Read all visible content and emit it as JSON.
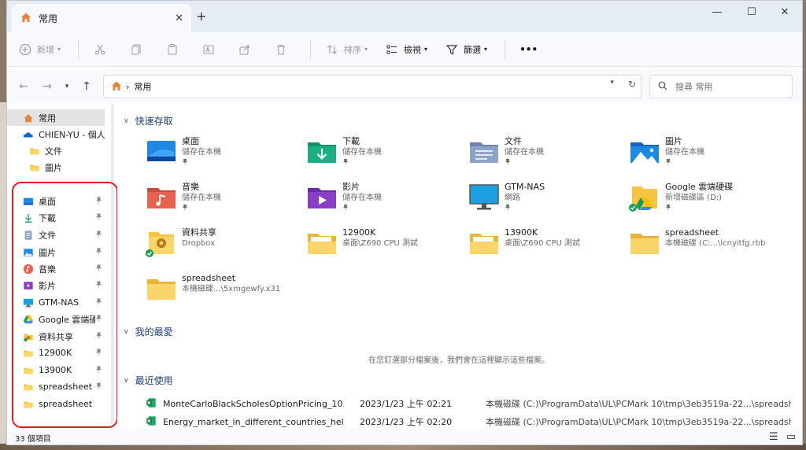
{
  "window": {
    "tab_title": "常用",
    "tab_close": "✕",
    "new_tab": "+",
    "minimize": "—",
    "maximize": "☐",
    "close": "✕"
  },
  "toolbar": {
    "new_label": "新增",
    "sort_label": "排序",
    "view_label": "檢視",
    "filter_label": "篩選",
    "more_label": "•••"
  },
  "address": {
    "path": "常用",
    "separator": "›",
    "search_placeholder": "搜尋 常用"
  },
  "sidebar": {
    "items": [
      {
        "label": "常用",
        "icon": "home-icon",
        "pinned": false,
        "active": true
      },
      {
        "label": "CHIEN-YU - 個人",
        "icon": "onedrive-icon",
        "pinned": false
      },
      {
        "label": "文件",
        "icon": "folder-icon",
        "pinned": false
      },
      {
        "label": "圖片",
        "icon": "folder-icon",
        "pinned": false
      },
      {
        "label": "桌面",
        "icon": "desktop-icon",
        "pinned": true
      },
      {
        "label": "下載",
        "icon": "download-icon",
        "pinned": true
      },
      {
        "label": "文件",
        "icon": "documents-icon",
        "pinned": true
      },
      {
        "label": "圖片",
        "icon": "pictures-icon",
        "pinned": true
      },
      {
        "label": "音樂",
        "icon": "music-icon",
        "pinned": true
      },
      {
        "label": "影片",
        "icon": "videos-icon",
        "pinned": true
      },
      {
        "label": "GTM-NAS",
        "icon": "monitor-icon",
        "pinned": true
      },
      {
        "label": "Google 雲端硬",
        "icon": "google-drive-icon",
        "pinned": true
      },
      {
        "label": "資料共享",
        "icon": "dropbox-folder-icon",
        "pinned": true
      },
      {
        "label": "12900K",
        "icon": "folder-icon",
        "pinned": true
      },
      {
        "label": "13900K",
        "icon": "folder-icon",
        "pinned": true
      },
      {
        "label": "spreadsheet",
        "icon": "folder-icon",
        "pinned": true
      },
      {
        "label": "spreadsheet",
        "icon": "folder-icon",
        "pinned": false
      }
    ],
    "pin_glyph": "📌"
  },
  "quick_access": {
    "heading": "快速存取",
    "items": [
      {
        "name": "桌面",
        "sub": "儲存在本機",
        "icon": "desktop"
      },
      {
        "name": "下載",
        "sub": "儲存在本機",
        "icon": "download"
      },
      {
        "name": "文件",
        "sub": "儲存在本機",
        "icon": "documents"
      },
      {
        "name": "圖片",
        "sub": "儲存在本機",
        "icon": "pictures"
      },
      {
        "name": "音樂",
        "sub": "儲存在本機",
        "icon": "music"
      },
      {
        "name": "影片",
        "sub": "儲存在本機",
        "icon": "videos"
      },
      {
        "name": "GTM-NAS",
        "sub": "網路",
        "icon": "monitor"
      },
      {
        "name": "Google 雲端硬碟",
        "sub": "新增磁碟區 (D:)",
        "icon": "gdrive"
      },
      {
        "name": "資料共享",
        "sub": "Dropbox",
        "icon": "dropbox"
      },
      {
        "name": "12900K",
        "sub": "桌面\\Z690 CPU 測試",
        "icon": "folder-files"
      },
      {
        "name": "13900K",
        "sub": "桌面\\Z690 CPU 測試",
        "icon": "folder-files"
      },
      {
        "name": "spreadsheet",
        "sub": "本機磁碟 (C:...\\lcnyitfg.rbb",
        "icon": "folder"
      },
      {
        "name": "spreadsheet",
        "sub": "本機磁碟...\\5xmgewfy.x31",
        "icon": "folder"
      }
    ]
  },
  "favorites": {
    "heading": "我的最愛",
    "empty_message": "在您釘選部分檔案後，我們會在這裡顯示這些檔案。"
  },
  "recent": {
    "heading": "最近使用",
    "rows": [
      {
        "name": "MonteCarloBlackScholesOptionPricing_10...",
        "date": "2023/1/23 上午 02:21",
        "path": "本機磁碟 (C:)\\ProgramData\\UL\\PCMark 10\\tmp\\3eb3519a-22...\\spreadsheet"
      },
      {
        "name": "Energy_market_in_different_countries_help...",
        "date": "2023/1/23 上午 02:20",
        "path": "本機磁碟 (C:)\\ProgramData\\UL\\PCMark 10\\tmp\\3eb3519a-22...\\spreadsheet"
      }
    ]
  },
  "status": {
    "item_count": "33 個項目"
  },
  "colors": {
    "accent": "#0067c0",
    "folder": "#f5c542",
    "highlight": "#e01a1a"
  }
}
